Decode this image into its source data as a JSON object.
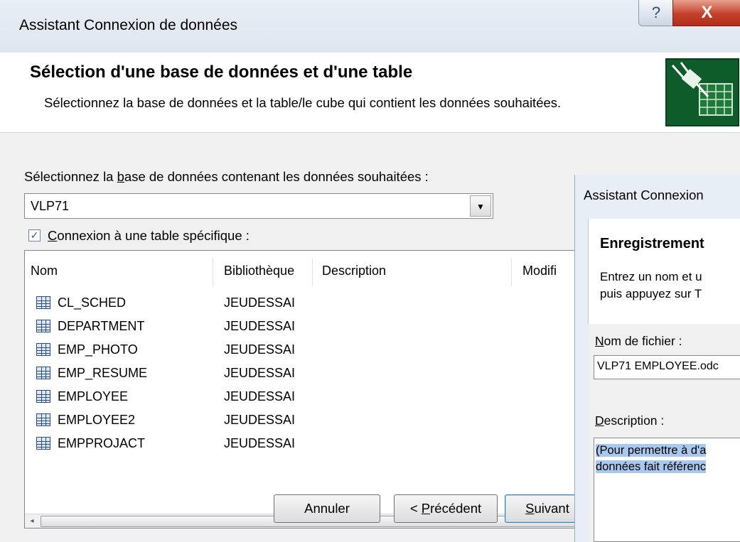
{
  "main_dialog": {
    "title": "Assistant Connexion de données",
    "header_title": "Sélection d'une base de données et d'une table",
    "header_subtitle": "Sélectionnez la base de données et la table/le cube qui contient les données souhaitées.",
    "icon": "plug-grid-icon",
    "database_label_pre": "Sélectionnez la ",
    "database_label_accel": "b",
    "database_label_post": "ase de données contenant les données souhaitées :",
    "database_value": "VLP71",
    "specific_table_checked": true,
    "specific_table_accel": "C",
    "specific_table_post": "onnexion à une table spécifique :",
    "columns": [
      "Nom",
      "Bibliothèque",
      "Description",
      "Modifi"
    ],
    "rows": [
      {
        "name": "CL_SCHED",
        "library": "JEUDESSAI"
      },
      {
        "name": "DEPARTMENT",
        "library": "JEUDESSAI"
      },
      {
        "name": "EMP_PHOTO",
        "library": "JEUDESSAI"
      },
      {
        "name": "EMP_RESUME",
        "library": "JEUDESSAI"
      },
      {
        "name": "EMPLOYEE",
        "library": "JEUDESSAI"
      },
      {
        "name": "EMPLOYEE2",
        "library": "JEUDESSAI"
      },
      {
        "name": "EMPPROJACT",
        "library": "JEUDESSAI"
      }
    ],
    "scroll_left": "◂",
    "scroll_grip": "III",
    "buttons": {
      "cancel": "Annuler",
      "prev_pre": "< ",
      "prev_accel": "P",
      "prev_post": "récédent",
      "next_accel": "S",
      "next_post": "uivant"
    },
    "caption_help": "?",
    "caption_close": "X"
  },
  "second_dialog": {
    "title": "Assistant Connexion",
    "header_title": "Enregistrement",
    "instruction_line1": "Entrez un nom et u",
    "instruction_line2": "puis appuyez sur T",
    "file_label_accel": "N",
    "file_label_post": "om de fichier :",
    "file_value": "VLP71 EMPLOYEE.odc",
    "desc_label_accel": "D",
    "desc_label_post": "escription :",
    "desc_line1": "(Pour permettre à d'a",
    "desc_line2": "données fait référenc"
  }
}
